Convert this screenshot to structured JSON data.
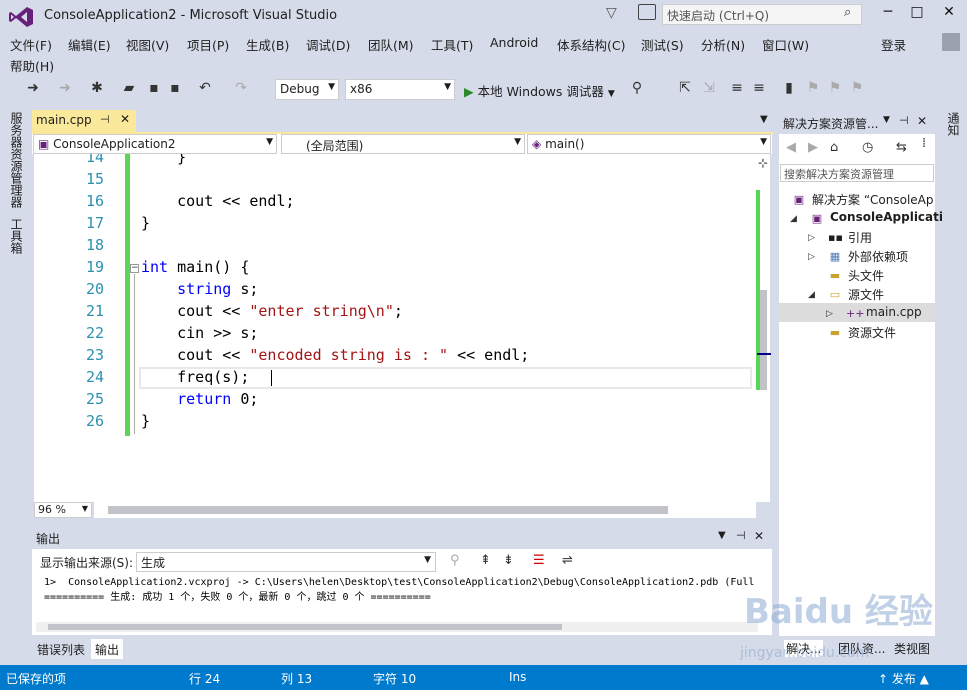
{
  "titlebar": {
    "title": "ConsoleApplication2 - Microsoft Visual Studio",
    "quick_launch_placeholder": "快速启动 (Ctrl+Q)",
    "minimize": "─",
    "maximize": "□",
    "close": "✕"
  },
  "menu": [
    "文件(F)",
    "编辑(E)",
    "视图(V)",
    "项目(P)",
    "生成(B)",
    "调试(D)",
    "团队(M)",
    "工具(T)",
    "Android",
    "体系结构(C)",
    "测试(S)",
    "分析(N)",
    "窗口(W)",
    "帮助(H)"
  ],
  "login": "登录",
  "toolbar": {
    "config": "Debug",
    "platform": "x86",
    "run_label": "本地 Windows 调试器",
    "play": "▶"
  },
  "left_strip": {
    "server_explorer": "服务器资源管理器",
    "toolbox": "工具箱"
  },
  "right_strip": {
    "notifications": "通知"
  },
  "document": {
    "tab_label": "main.cpp",
    "pin": "⊣",
    "close": "✕",
    "nav_project": "ConsoleApplication2",
    "nav_scope": "(全局范围)",
    "nav_member": "main()"
  },
  "code": {
    "line_numbers": [
      "14",
      "15",
      "16",
      "17",
      "18",
      "19",
      "20",
      "21",
      "22",
      "23",
      "24",
      "25",
      "26"
    ],
    "lines": [
      [
        {
          "t": "    }",
          "c": ""
        }
      ],
      [],
      [
        {
          "t": "    cout ",
          "c": ""
        },
        {
          "t": "<<",
          "c": ""
        },
        {
          "t": " endl;",
          "c": ""
        }
      ],
      [
        {
          "t": "}",
          "c": ""
        }
      ],
      [],
      [
        {
          "t": "int",
          "c": "kw"
        },
        {
          "t": " main() {",
          "c": ""
        }
      ],
      [
        {
          "t": "    ",
          "c": ""
        },
        {
          "t": "string",
          "c": "kw"
        },
        {
          "t": " s;",
          "c": ""
        }
      ],
      [
        {
          "t": "    cout << ",
          "c": ""
        },
        {
          "t": "\"enter string\\n\"",
          "c": "str"
        },
        {
          "t": ";",
          "c": ""
        }
      ],
      [
        {
          "t": "    cin >> s;",
          "c": ""
        }
      ],
      [
        {
          "t": "    cout << ",
          "c": ""
        },
        {
          "t": "\"encoded string is : \"",
          "c": "str"
        },
        {
          "t": " << endl;",
          "c": ""
        }
      ],
      [
        {
          "t": "    freq(s);",
          "c": ""
        }
      ],
      [
        {
          "t": "    ",
          "c": ""
        },
        {
          "t": "return",
          "c": "kw"
        },
        {
          "t": " 0;",
          "c": ""
        }
      ],
      [
        {
          "t": "}",
          "c": ""
        }
      ]
    ]
  },
  "zoom": "96 %",
  "output": {
    "title": "输出",
    "source_label": "显示输出来源(S):",
    "source_value": "生成",
    "line1": "1>  ConsoleApplication2.vcxproj -> C:\\Users\\helen\\Desktop\\test\\ConsoleApplication2\\Debug\\ConsoleApplication2.pdb (Full",
    "line2": "========== 生成: 成功 1 个，失败 0 个，最新 0 个，跳过 0 个 =========="
  },
  "bottom_tabs": [
    "错误列表",
    "输出"
  ],
  "solution_explorer": {
    "title": "解决方案资源管...",
    "search_placeholder": "搜索解决方案资源管理",
    "items": [
      {
        "label": "解决方案 “ConsoleAp",
        "bold": false
      },
      {
        "label": "ConsoleApplicati",
        "bold": true
      },
      {
        "label": "引用",
        "bold": false
      },
      {
        "label": "外部依赖项",
        "bold": false
      },
      {
        "label": "头文件",
        "bold": false
      },
      {
        "label": "源文件",
        "bold": false
      },
      {
        "label": "main.cpp",
        "bold": false
      },
      {
        "label": "资源文件",
        "bold": false
      }
    ],
    "bottom_tabs": [
      "解决...",
      "团队资...",
      "类视图"
    ]
  },
  "status": {
    "left": "已保存的项",
    "line": "行 24",
    "col": "列 13",
    "char": "字符 10",
    "ins": "Ins",
    "publish": "↑ 发布 ▲"
  },
  "watermark": {
    "logo": "Baidu 经验",
    "url": "jingyan.baidu.com"
  }
}
